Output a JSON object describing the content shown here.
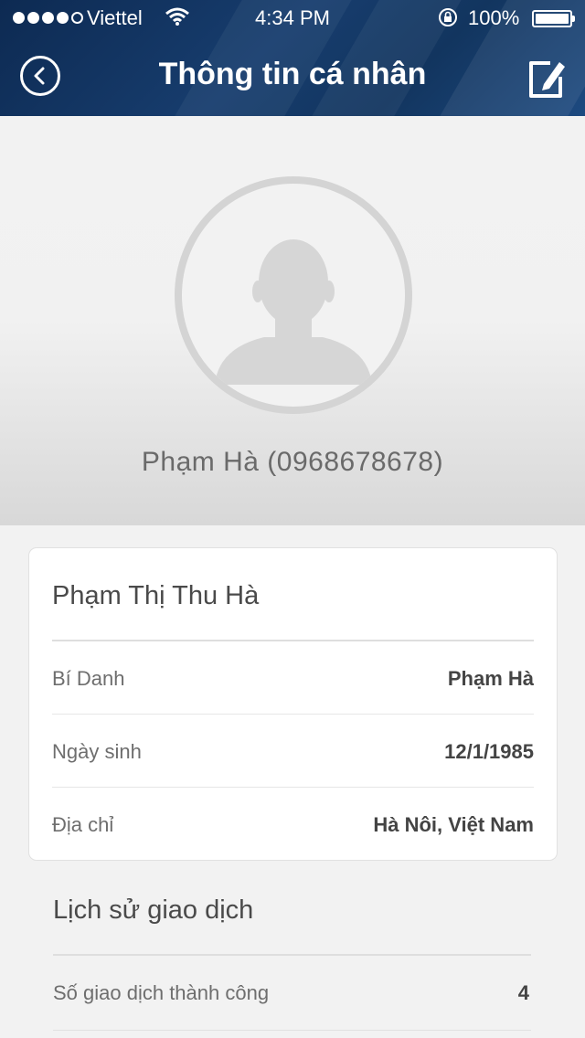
{
  "status_bar": {
    "carrier": "Viettel",
    "time": "4:34 PM",
    "battery": "100%",
    "signal_icon": "signal-dots-icon",
    "wifi_icon": "wifi-icon",
    "lock_icon": "rotation-lock-icon",
    "battery_icon": "battery-icon"
  },
  "header": {
    "title": "Thông tin cá nhân",
    "back_icon": "back-circle-icon",
    "edit_icon": "edit-icon"
  },
  "profile": {
    "display": "Phạm Hà (0968678678)",
    "avatar_icon": "user-silhouette-icon"
  },
  "card": {
    "full_name": "Phạm Thị Thu Hà",
    "rows": [
      {
        "label": "Bí Danh",
        "value": "Phạm Hà"
      },
      {
        "label": "Ngày sinh",
        "value": "12/1/1985"
      },
      {
        "label": "Địa chỉ",
        "value": "Hà Nôi, Việt Nam"
      }
    ]
  },
  "history": {
    "title": "Lịch sử giao dịch",
    "rows": [
      {
        "label": "Số giao dịch thành công",
        "value": "4"
      }
    ]
  },
  "colors": {
    "header_bg": "#173d6e",
    "page_bg": "#f2f2f2",
    "card_bg": "#ffffff",
    "text_primary": "#4a4a4a",
    "text_secondary": "#6e6e6e",
    "avatar_gray": "#d4d4d4"
  }
}
